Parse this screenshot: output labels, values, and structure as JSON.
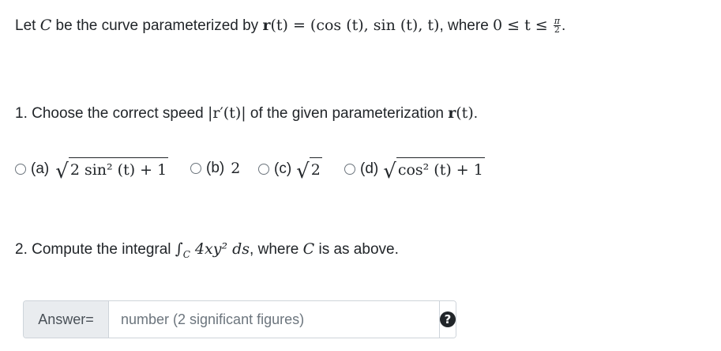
{
  "intro": {
    "text1": "Let ",
    "C": "C",
    "text2": " be the curve parameterized by ",
    "r": "r",
    "rt_expr": "(t) = (cos (t),  sin (t),  t)",
    "text3": ", where ",
    "range": "0 ≤ t ≤ ",
    "pi": "π",
    "two": "2",
    "period": "."
  },
  "q1": {
    "text1": "1. Choose the correct speed ",
    "speed": "|r′(t)|",
    "text2": " of the given parameterization ",
    "r": "r",
    "t": "(t)",
    "period": "."
  },
  "options": [
    {
      "label": "(a)",
      "expr": "2 sin² (t) + 1"
    },
    {
      "label": "(b)",
      "expr": "2"
    },
    {
      "label": "(c)",
      "expr": "2"
    },
    {
      "label": "(d)",
      "expr": "cos² (t) + 1"
    }
  ],
  "q2": {
    "text1": "2. Compute the integral ",
    "integral": "∫",
    "sub": "C",
    "expr": " 4xy² ds",
    "text2": ", where ",
    "C": "C",
    "text3": " is as above."
  },
  "answer": {
    "label": "Answer=",
    "placeholder": "number (2 significant figures)",
    "value": "",
    "help": "?"
  }
}
